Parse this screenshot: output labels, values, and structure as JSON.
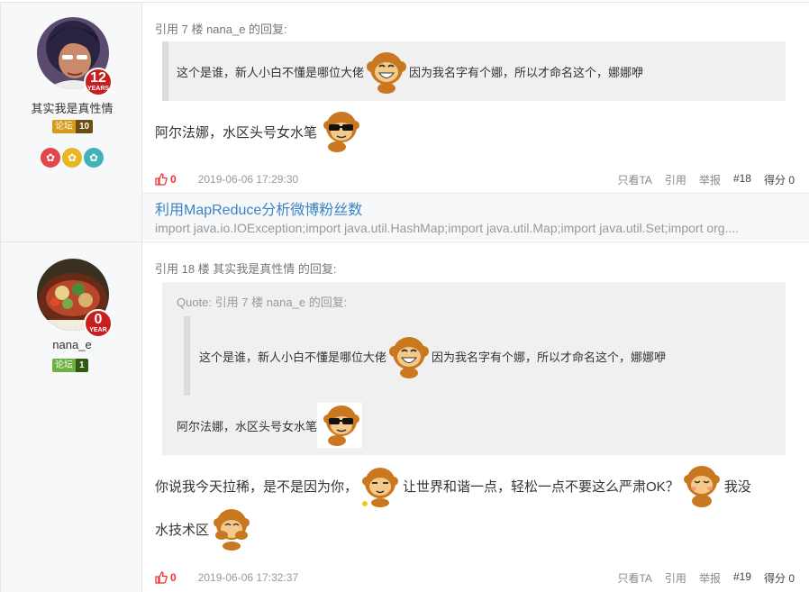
{
  "posts": [
    {
      "user": {
        "name": "其实我是真性情",
        "years": "12",
        "years_label": "YEARS",
        "forum_label": "论坛",
        "forum_level": "10"
      },
      "medals": [
        "✿",
        "✿",
        "✿"
      ],
      "cite_head": "引用 7 楼 nana_e 的回复:",
      "quote": {
        "text1": "这个是谁，新人小白不懂是哪位大佬",
        "text2": "因为我名字有个娜，所以才命名这个，娜娜咿"
      },
      "body": {
        "text": "阿尔法娜，水区头号女水笔"
      },
      "likes": "0",
      "time": "2019-06-06 17:29:30",
      "actions": {
        "only_ta": "只看TA",
        "cite": "引用",
        "report": "举报",
        "floor": "#18",
        "score": "得分 0"
      }
    },
    {
      "user": {
        "name": "nana_e",
        "years": "0",
        "years_label": "YEAR",
        "forum_label": "论坛",
        "forum_level": "1"
      },
      "cite_head": "引用 18 楼 其实我是真性情 的回复:",
      "quote_head": "Quote: 引用 7 楼 nana_e 的回复:",
      "inner_quote": {
        "text1": "这个是谁，新人小白不懂是哪位大佬",
        "text2": "因为我名字有个娜，所以才命名这个，娜娜咿"
      },
      "quote_line2": "阿尔法娜，水区头号女水笔",
      "reply": {
        "part1": "你说我今天拉稀，是不是因为你，",
        "part2": "让世界和谐一点，轻松一点不要这么严肃OK？",
        "part3": "我没",
        "part4": "水技术区"
      },
      "likes": "0",
      "time": "2019-06-06 17:32:37",
      "actions": {
        "only_ta": "只看TA",
        "cite": "引用",
        "report": "举报",
        "floor": "#19",
        "score": "得分 0"
      }
    }
  ],
  "blog": {
    "title": "利用MapReduce分析微博粉丝数",
    "desc": "import java.io.IOException;import java.util.HashMap;import java.util.Map;import java.util.Set;import org...."
  },
  "colors": {
    "like": "#e33333",
    "link": "#3b82c4",
    "years_badge": "#c81e1e"
  },
  "icons": [
    "thumb-up-icon",
    "monkey-laugh-emoji",
    "monkey-sunglasses-emoji",
    "monkey-sleepy-emoji",
    "monkey-shy-emoji",
    "monkey-cover-emoji"
  ]
}
